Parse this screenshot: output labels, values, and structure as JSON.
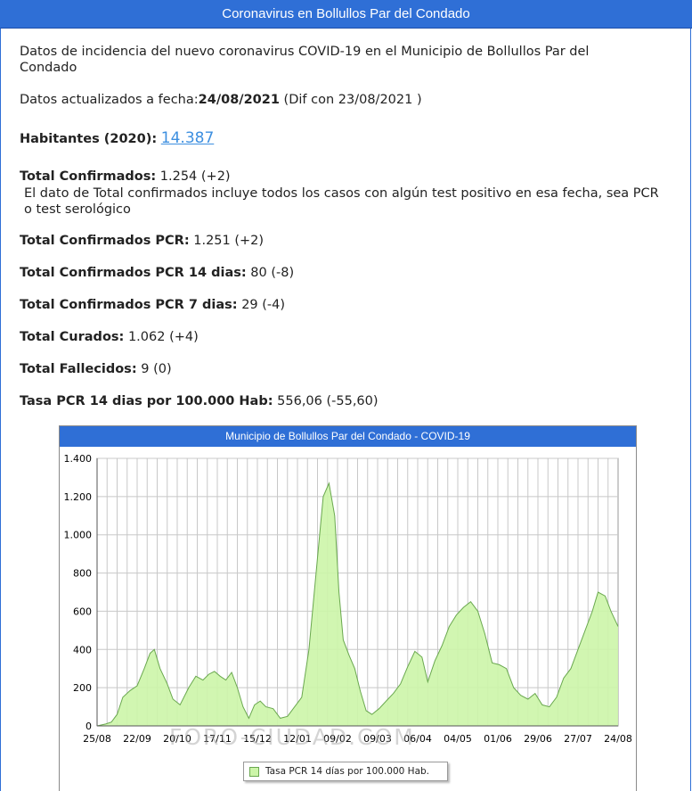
{
  "header": {
    "title": "Coronavirus en Bollullos Par del Condado"
  },
  "intro": {
    "line1": "Datos de incidencia del nuevo coronavirus COVID-19 en el Municipio de Bollullos Par del",
    "line2": "Condado"
  },
  "update": {
    "label": "Datos actualizados a fecha:",
    "date": "24/08/2021",
    "diff": " (Dif con 23/08/2021 )"
  },
  "habitantes": {
    "label": "Habitantes (2020):",
    "value": "14.387"
  },
  "stats": {
    "confirmados": {
      "label": "Total Confirmados:",
      "value": "1.254 (+2)"
    },
    "note": "El dato de Total confirmados incluye todos los casos con algún test positivo en esa fecha, sea PCR o test serológico",
    "pcr": {
      "label": "Total Confirmados PCR:",
      "value": "1.251 (+2)"
    },
    "pcr14": {
      "label": "Total Confirmados PCR 14 dias:",
      "value": "80 (-8)"
    },
    "pcr7": {
      "label": "Total Confirmados PCR 7 dias:",
      "value": "29 (-4)"
    },
    "curados": {
      "label": "Total Curados:",
      "value": "1.062 (+4)"
    },
    "fallecidos": {
      "label": "Total Fallecidos:",
      "value": "9 (0)"
    },
    "tasa": {
      "label": "Tasa PCR 14 dias por 100.000 Hab:",
      "value": "556,06 (-55,60)"
    }
  },
  "watermark": "FORO-CIUDAD.COM",
  "colors": {
    "brand": "#2f6fd6",
    "series_fill": "#ccf5a8",
    "series_line": "#6aa84f",
    "link": "#3d8fe0"
  },
  "chart_data": {
    "type": "area",
    "title": "Municipio de Bollullos Par del Condado - COVID-19",
    "ylim": [
      0,
      1400
    ],
    "yticks": [
      0,
      200,
      400,
      600,
      800,
      1000,
      1200,
      1400
    ],
    "ytick_labels": [
      "0",
      "200",
      "400",
      "600",
      "800",
      "1.000",
      "1.200",
      "1.400"
    ],
    "xlim": [
      "2020-08-25",
      "2021-08-24"
    ],
    "xticks": [
      "2020-08-25",
      "2020-09-22",
      "2020-10-20",
      "2020-11-17",
      "2020-12-15",
      "2021-01-12",
      "2021-02-09",
      "2021-03-09",
      "2021-04-06",
      "2021-05-04",
      "2021-06-01",
      "2021-06-29",
      "2021-07-27",
      "2021-08-24"
    ],
    "xtick_labels": [
      "25/08",
      "22/09",
      "20/10",
      "17/11",
      "15/12",
      "12/01",
      "09/02",
      "09/03",
      "06/04",
      "04/05",
      "01/06",
      "29/06",
      "27/07",
      "24/08"
    ],
    "grid": true,
    "legend_position": "bottom-center",
    "series": [
      {
        "name": "Tasa PCR 14 días por 100.000 Hab.",
        "x": [
          "2020-08-25",
          "2020-08-31",
          "2020-09-04",
          "2020-09-08",
          "2020-09-12",
          "2020-09-17",
          "2020-09-22",
          "2020-09-27",
          "2020-10-01",
          "2020-10-04",
          "2020-10-08",
          "2020-10-13",
          "2020-10-17",
          "2020-10-22",
          "2020-10-28",
          "2020-11-02",
          "2020-11-07",
          "2020-11-11",
          "2020-11-15",
          "2020-11-19",
          "2020-11-23",
          "2020-11-27",
          "2020-12-01",
          "2020-12-05",
          "2020-12-09",
          "2020-12-13",
          "2020-12-17",
          "2020-12-21",
          "2020-12-26",
          "2020-12-31",
          "2021-01-05",
          "2021-01-10",
          "2021-01-15",
          "2021-01-20",
          "2021-01-25",
          "2021-01-30",
          "2021-02-03",
          "2021-02-07",
          "2021-02-10",
          "2021-02-13",
          "2021-02-17",
          "2021-02-21",
          "2021-02-25",
          "2021-03-01",
          "2021-03-05",
          "2021-03-10",
          "2021-03-15",
          "2021-03-20",
          "2021-03-25",
          "2021-03-30",
          "2021-04-04",
          "2021-04-09",
          "2021-04-13",
          "2021-04-18",
          "2021-04-23",
          "2021-04-28",
          "2021-05-03",
          "2021-05-08",
          "2021-05-13",
          "2021-05-18",
          "2021-05-23",
          "2021-05-28",
          "2021-06-02",
          "2021-06-07",
          "2021-06-12",
          "2021-06-17",
          "2021-06-22",
          "2021-06-27",
          "2021-07-02",
          "2021-07-07",
          "2021-07-12",
          "2021-07-17",
          "2021-07-22",
          "2021-07-27",
          "2021-08-01",
          "2021-08-06",
          "2021-08-10",
          "2021-08-15",
          "2021-08-19",
          "2021-08-24"
        ],
        "values": [
          0,
          10,
          20,
          60,
          150,
          185,
          210,
          300,
          380,
          400,
          300,
          220,
          140,
          110,
          200,
          260,
          240,
          270,
          285,
          260,
          240,
          280,
          200,
          100,
          40,
          110,
          130,
          100,
          90,
          40,
          50,
          100,
          150,
          400,
          800,
          1200,
          1270,
          1100,
          700,
          450,
          370,
          300,
          180,
          80,
          60,
          90,
          130,
          170,
          220,
          310,
          390,
          360,
          230,
          340,
          420,
          520,
          580,
          620,
          650,
          600,
          480,
          330,
          320,
          300,
          200,
          160,
          140,
          170,
          110,
          100,
          150,
          250,
          300,
          400,
          500,
          600,
          700,
          680,
          600,
          520
        ]
      }
    ]
  }
}
